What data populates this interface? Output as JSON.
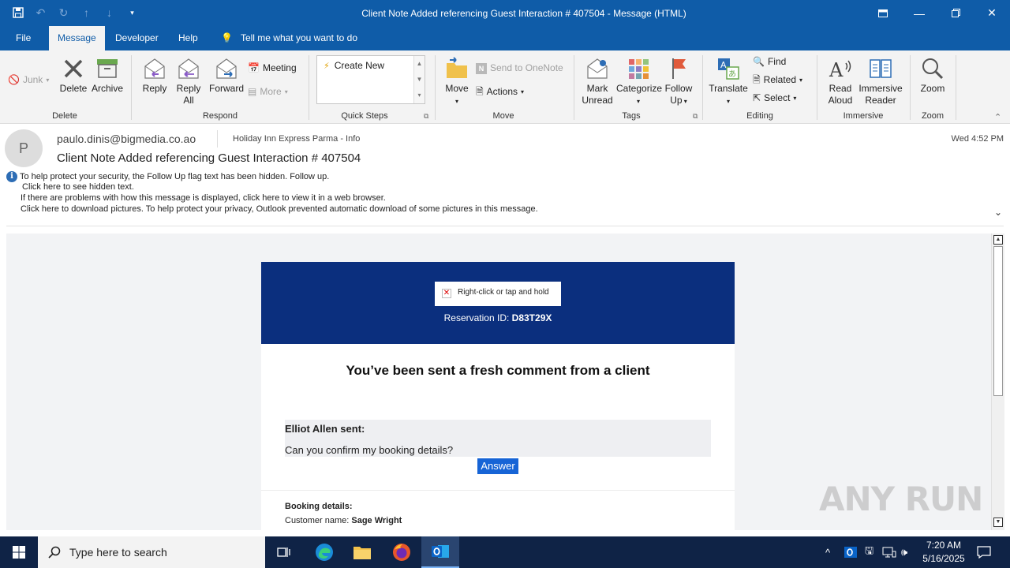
{
  "window": {
    "title": "Client Note Added referencing Guest Interaction # 407504",
    "title_suffix": "-  Message (HTML)"
  },
  "menu_tabs": [
    "File",
    "Message",
    "Developer",
    "Help"
  ],
  "tell_me": "Tell me what you want to do",
  "ribbon": {
    "delete_group": {
      "label": "Delete",
      "junk": "Junk",
      "delete": "Delete",
      "archive": "Archive"
    },
    "respond_group": {
      "label": "Respond",
      "reply": "Reply",
      "reply_all_1": "Reply",
      "reply_all_2": "All",
      "forward": "Forward",
      "meeting": "Meeting",
      "more": "More"
    },
    "quick_steps": {
      "label": "Quick Steps",
      "create_new": "Create New"
    },
    "move_group": {
      "label": "Move",
      "move": "Move",
      "send_onenote": "Send to OneNote",
      "actions": "Actions"
    },
    "tags_group": {
      "label": "Tags",
      "mark_unread_1": "Mark",
      "mark_unread_2": "Unread",
      "categorize": "Categorize",
      "follow_up_1": "Follow",
      "follow_up_2": "Up"
    },
    "editing_group": {
      "label": "Editing",
      "translate": "Translate",
      "find": "Find",
      "related": "Related",
      "select": "Select"
    },
    "immersive_group": {
      "label": "Immersive",
      "read_aloud_1": "Read",
      "read_aloud_2": "Aloud",
      "immersive_reader_1": "Immersive",
      "immersive_reader_2": "Reader"
    },
    "zoom_group": {
      "label": "Zoom",
      "zoom": "Zoom"
    }
  },
  "message": {
    "avatar_initial": "P",
    "from": "paulo.dinis@bigmedia.co.ao",
    "to": "Holiday Inn Express Parma - Info",
    "date": "Wed 4:52 PM",
    "subject": "Client Note Added referencing Guest Interaction # 407504",
    "info_lines": [
      "To help protect your security, the Follow Up flag text has been hidden. Follow up.",
      " Click here to see hidden text.",
      "If there are problems with how this message is displayed, click here to view it in a web browser.",
      "Click here to download pictures. To help protect your privacy, Outlook prevented automatic download of some pictures in this message."
    ]
  },
  "email": {
    "image_placeholder": "Right-click or tap and hold",
    "reservation_label": "Reservation ID:",
    "reservation_id": "D83T29X",
    "headline": "You’ve been sent a fresh comment from a client",
    "comment_from": "Elliot Allen sent:",
    "comment_text": "Can you confirm my booking details?",
    "answer_button": "Answer",
    "booking_title": "Booking details:",
    "customer_label": "Customer name:",
    "customer_name": "Sage Wright"
  },
  "watermark": "ANY RUN",
  "taskbar": {
    "search_placeholder": "Type here to search",
    "time": "7:20 AM",
    "date": "5/16/2025"
  }
}
